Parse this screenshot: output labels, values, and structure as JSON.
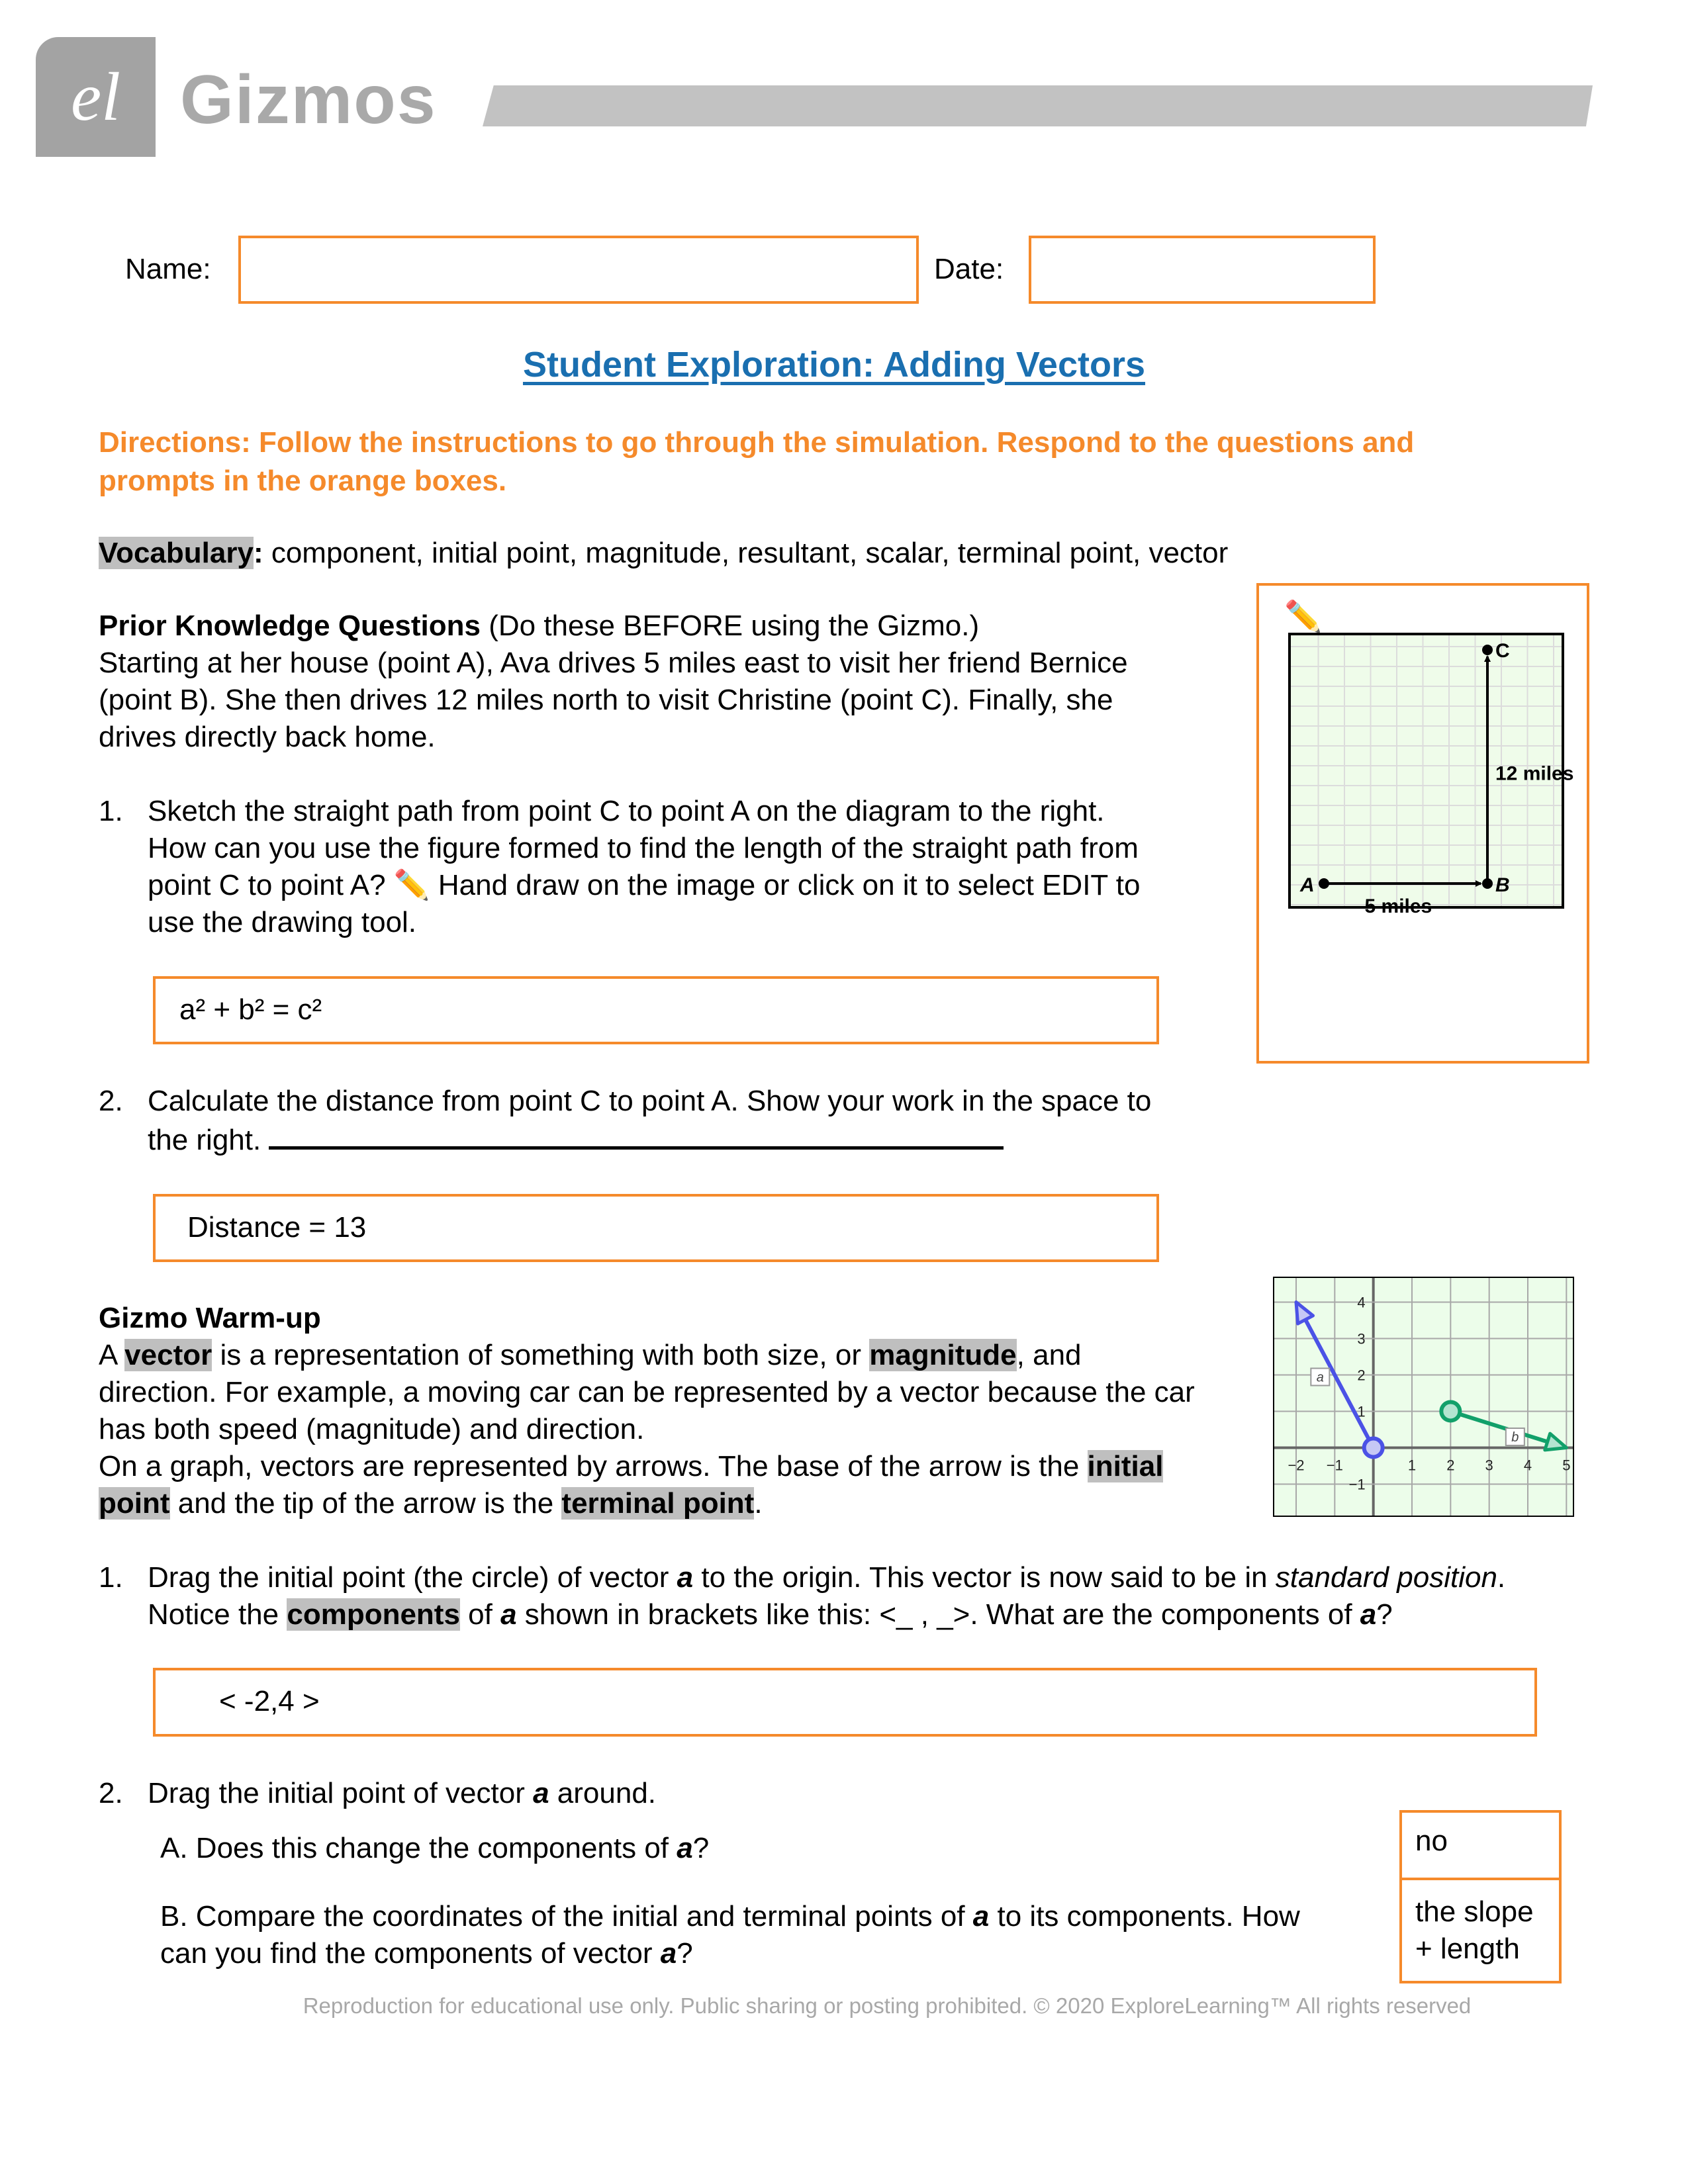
{
  "header": {
    "logo_glyph": "el",
    "brand": "Gizmos"
  },
  "form": {
    "name_label": "Name:",
    "name_value": "",
    "date_label": "Date:",
    "date_value": ""
  },
  "title": "Student Exploration: Adding Vectors",
  "directions_line1": "Directions: Follow the instructions to go through the simulation. Respond to the questions and",
  "directions_line2": "prompts in the orange boxes.",
  "vocabulary": {
    "label": "Vocabulary",
    "colon": ":",
    "terms": " component, initial point, magnitude, resultant, scalar, terminal point, vector"
  },
  "prior_knowledge": {
    "heading": "Prior Knowledge Questions",
    "heading_note": " (Do these BEFORE using the Gizmo.)",
    "lines": [
      "Starting at her house (point A), Ava drives 5 miles east to visit her friend Bernice",
      "(point B). She then drives 12 miles north to visit Christine (point C). Finally, she",
      "drives directly back home."
    ],
    "q1_number": "1.",
    "q1_lines": [
      "Sketch the straight path from point C to point A on the diagram to the right.",
      "How can you use the figure formed to find the length of the straight path from",
      "point C to point A?",
      " Hand draw on the image or click on it to select EDIT to",
      "use the drawing tool."
    ],
    "q1_answer": "a² + b² = c²",
    "q2_number": "2.",
    "q2_line1": "Calculate the distance from point C to point A. Show your work in the space to",
    "q2_line2": "the right.",
    "q2_answer": "Distance = 13"
  },
  "diagram": {
    "pencil_icon": "pencil-icon",
    "point_a": "A",
    "point_b": "B",
    "point_c": "C",
    "label_east": "5 miles",
    "label_north": "12 miles",
    "east_miles": 5,
    "north_miles": 12
  },
  "warmup": {
    "heading": "Gizmo Warm-up",
    "p1_pre": "A ",
    "p1_vector": "vector",
    "p1_mid": " is a representation of something with both size, or ",
    "p1_magnitude": "magnitude",
    "p1_post": ", and",
    "p2": "direction. For example, a moving car can be represented by a vector because the car",
    "p3": "has both speed (magnitude) and direction.",
    "p4_pre": "On a graph, vectors are represented by arrows. The base of the arrow is the ",
    "p4_initial": "initial",
    "p5_point": "point",
    "p5_mid": " and the tip of the arrow is the ",
    "p5_terminal": "terminal point",
    "p5_post": ".",
    "q1_number": "1.",
    "q1_l1_pre": "Drag the initial point (the circle) of vector ",
    "q1_l1_a": "a",
    "q1_l1_mid": " to the origin. This vector is now said to be in ",
    "q1_l1_std": "standard position",
    "q1_l1_post": ".",
    "q1_l2_pre": "Notice the ",
    "q1_l2_components": "components",
    "q1_l2_mid": " of ",
    "q1_l2_a": "a",
    "q1_l2_mid2": " shown in brackets like this: <_ , _>. What are the components of ",
    "q1_l2_a2": "a",
    "q1_l2_post": "?",
    "q1_answer": "< -2,4 >",
    "q2_number": "2.",
    "q2_pre": "Drag the initial point of vector ",
    "q2_a": "a",
    "q2_post": " around.",
    "q2a_pre": "A. Does this change the components of ",
    "q2a_a": "a",
    "q2a_post": "?",
    "q2a_answer": "no",
    "q2b_l1_pre": "B. Compare the coordinates of the initial and terminal points of ",
    "q2b_l1_a": "a",
    "q2b_l1_post": " to its components. How",
    "q2b_l2_pre": "can you find the components of vector ",
    "q2b_l2_a": "a",
    "q2b_l2_post": "?",
    "q2b_answer_l1": "the slope",
    "q2b_answer_l2": "+ length"
  },
  "vector_graph": {
    "x_ticks": [
      "−2",
      "−1",
      "1",
      "2",
      "3",
      "4",
      "5"
    ],
    "y_ticks": [
      "4",
      "3",
      "2",
      "1",
      "−1"
    ],
    "xlim": [
      -2.6,
      5.2
    ],
    "ylim": [
      -1.9,
      4.7
    ],
    "vectors": [
      {
        "name": "a",
        "label": "a",
        "initial": [
          0,
          0
        ],
        "terminal": [
          -2,
          4
        ],
        "color": "#4b52e6",
        "fill": "#c6c8f5"
      },
      {
        "name": "b",
        "label": "b",
        "initial": [
          2,
          1
        ],
        "terminal": [
          5,
          0
        ],
        "color": "#12a06a",
        "fill": "#b3e4d0"
      }
    ],
    "grid_color": "#a8a8a8",
    "background": "#ecfdea"
  },
  "colors": {
    "accent_orange": "#f58a2b",
    "title_blue": "#1a6fb0",
    "highlight_gray": "#bfbfbf"
  },
  "footer": "Reproduction for educational use only. Public sharing or posting prohibited. © 2020 ExploreLearning™ All rights reserved"
}
